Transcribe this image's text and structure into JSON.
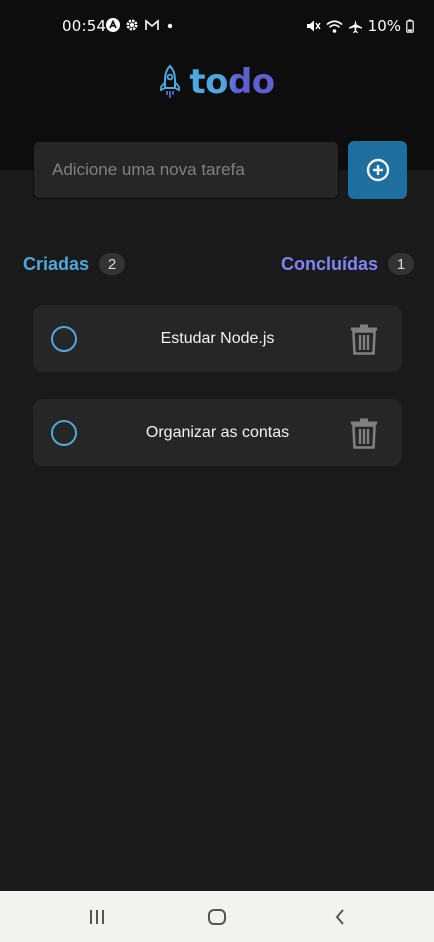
{
  "status_bar": {
    "time": "00:54",
    "battery": "10%"
  },
  "header": {
    "logo_text": "todo"
  },
  "new_task": {
    "placeholder": "Adicione uma nova tarefa",
    "value": ""
  },
  "counters": {
    "created_label": "Criadas",
    "created_count": "2",
    "done_label": "Concluídas",
    "done_count": "1"
  },
  "tasks": [
    {
      "text": "Estudar Node.js",
      "done": false
    },
    {
      "text": "Organizar as contas",
      "done": false
    }
  ],
  "icons": {
    "logo": "rocket-icon",
    "add": "plus-circle-icon",
    "check": "circle-icon",
    "delete": "trash-icon",
    "nav_recent": "recent-apps-icon",
    "nav_home": "home-icon",
    "nav_back": "back-icon"
  },
  "colors": {
    "blue": "#4ea8de",
    "purple": "#8284fa",
    "blue_dark": "#1e6f9f",
    "background": "#1a1a1a",
    "header": "#0d0d0d",
    "card": "#262626"
  }
}
